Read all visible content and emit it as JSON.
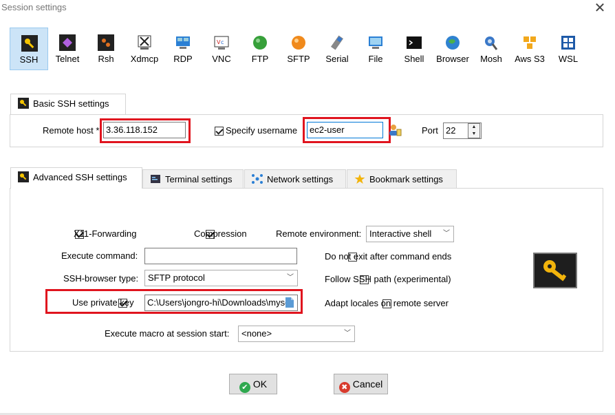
{
  "window": {
    "title": "Session settings"
  },
  "toolbar": {
    "items": [
      {
        "label": "SSH",
        "icon": "ssh-key-icon"
      },
      {
        "label": "Telnet",
        "icon": "telnet-icon"
      },
      {
        "label": "Rsh",
        "icon": "rsh-icon"
      },
      {
        "label": "Xdmcp",
        "icon": "xdmcp-icon"
      },
      {
        "label": "RDP",
        "icon": "rdp-icon"
      },
      {
        "label": "VNC",
        "icon": "vnc-icon"
      },
      {
        "label": "FTP",
        "icon": "ftp-icon"
      },
      {
        "label": "SFTP",
        "icon": "sftp-icon"
      },
      {
        "label": "Serial",
        "icon": "serial-icon"
      },
      {
        "label": "File",
        "icon": "file-icon"
      },
      {
        "label": "Shell",
        "icon": "shell-icon"
      },
      {
        "label": "Browser",
        "icon": "browser-icon"
      },
      {
        "label": "Mosh",
        "icon": "mosh-icon"
      },
      {
        "label": "Aws S3",
        "icon": "aws-s3-icon"
      },
      {
        "label": "WSL",
        "icon": "wsl-icon"
      }
    ]
  },
  "basic": {
    "tab_label": "Basic SSH settings",
    "remote_host_label": "Remote host *",
    "remote_host_value": "3.36.118.152",
    "specify_username_label": "Specify username",
    "username_value": "ec2-user",
    "port_label": "Port",
    "port_value": "22"
  },
  "tabs": {
    "advanced": "Advanced SSH settings",
    "terminal": "Terminal settings",
    "network": "Network settings",
    "bookmark": "Bookmark settings"
  },
  "advanced": {
    "x11_label": "X11-Forwarding",
    "compression_label": "Compression",
    "remote_env_label": "Remote environment:",
    "remote_env_value": "Interactive shell",
    "execute_command_label": "Execute command:",
    "execute_command_value": "",
    "do_not_exit_label": "Do not exit after command ends",
    "ssh_browser_label": "SSH-browser type:",
    "ssh_browser_value": "SFTP protocol",
    "follow_ssh_label": "Follow SSH path (experimental)",
    "private_key_label": "Use private key",
    "private_key_value": "C:\\Users\\jongro-hi\\Downloads\\myse",
    "adapt_locales_label": "Adapt locales on remote server",
    "macro_label": "Execute macro at session start:",
    "macro_value": "<none>"
  },
  "buttons": {
    "ok": "OK",
    "cancel": "Cancel"
  },
  "colors": {
    "highlight": "#e0141e",
    "active_tool": "#cce4f7",
    "ok_green": "#2fa84f",
    "cancel_red": "#d83b2d"
  }
}
